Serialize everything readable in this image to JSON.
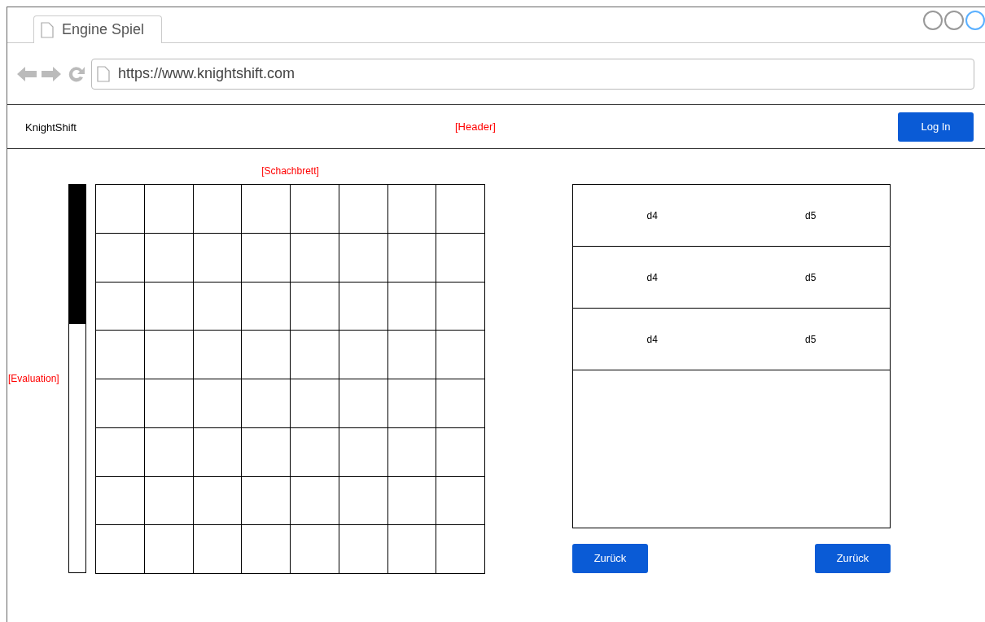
{
  "browser": {
    "tab": {
      "title": "Engine Spiel"
    },
    "address": "https://www.knightshift.com"
  },
  "header": {
    "brand": "KnightShift",
    "annotation": "[Header]",
    "login_button": "Log In"
  },
  "evaluation": {
    "annotation": "[Evaluation]",
    "level": 0.36
  },
  "board": {
    "annotation": "[Schachbrett]"
  },
  "moves": [
    {
      "white": "d4",
      "black": "d5"
    },
    {
      "white": "d4",
      "black": "d5"
    },
    {
      "white": "d4",
      "black": "d5"
    }
  ],
  "buttons": [
    "Zurück",
    "Zurück"
  ]
}
